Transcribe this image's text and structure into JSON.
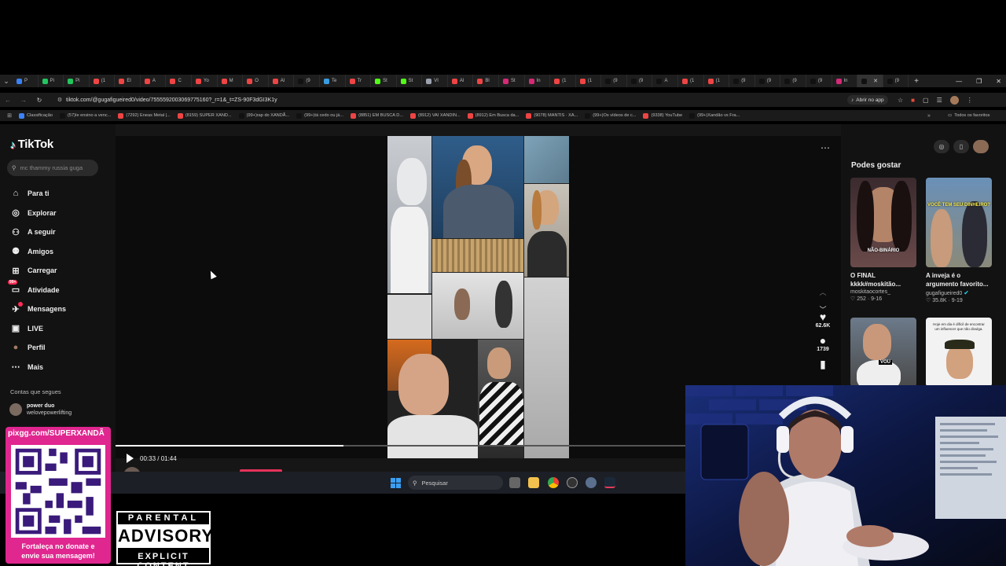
{
  "browser": {
    "tabs": [
      {
        "label": "P",
        "color": "#3b82f6"
      },
      {
        "label": "Pi",
        "color": "#22c55e"
      },
      {
        "label": "Pi",
        "color": "#22c55e"
      },
      {
        "label": "(1",
        "color": "#ef4444"
      },
      {
        "label": "El",
        "color": "#ef4444"
      },
      {
        "label": "A",
        "color": "#ef4444"
      },
      {
        "label": "C",
        "color": "#ef4444"
      },
      {
        "label": "Yo",
        "color": "#ef4444"
      },
      {
        "label": "M",
        "color": "#ef4444"
      },
      {
        "label": "O",
        "color": "#ef4444"
      },
      {
        "label": "Al",
        "color": "#ef4444"
      },
      {
        "label": "(9",
        "color": "#111111"
      },
      {
        "label": "Te",
        "color": "#3b9de0"
      },
      {
        "label": "Tr",
        "color": "#ef4444"
      },
      {
        "label": "St",
        "color": "#53fc18"
      },
      {
        "label": "St",
        "color": "#53fc18"
      },
      {
        "label": "VI",
        "color": "#9ca3af"
      },
      {
        "label": "Al",
        "color": "#ef4444"
      },
      {
        "label": "Bl",
        "color": "#ef4444"
      },
      {
        "label": "St",
        "color": "#d62976"
      },
      {
        "label": "In",
        "color": "#d62976"
      },
      {
        "label": "(1",
        "color": "#ef4444"
      },
      {
        "label": "(1",
        "color": "#ef4444"
      },
      {
        "label": "(9",
        "color": "#111111"
      },
      {
        "label": "(9",
        "color": "#111111"
      },
      {
        "label": "A",
        "color": "#111111"
      },
      {
        "label": "(1",
        "color": "#ef4444"
      },
      {
        "label": "(1",
        "color": "#ef4444"
      },
      {
        "label": "(9",
        "color": "#111111"
      },
      {
        "label": "(9",
        "color": "#111111"
      },
      {
        "label": "(9",
        "color": "#111111"
      },
      {
        "label": "(9",
        "color": "#111111"
      },
      {
        "label": "In",
        "color": "#d62976"
      },
      {
        "label": "",
        "color": "#111111",
        "active": true
      },
      {
        "label": "(9",
        "color": "#111111"
      }
    ],
    "url": "tiktok.com/@gugafigueired0/video/7555592003069775160?_r=1&_t=ZS-90F3dGI3K1y",
    "open_in_app": "Abrir no app",
    "bookmarks": [
      {
        "label": "Classificação",
        "color": "#3b82f6"
      },
      {
        "label": "(57)Ie ensino a venc...",
        "color": "#111111"
      },
      {
        "label": "(7292) Eneas Metal |...",
        "color": "#ef4444"
      },
      {
        "label": "(8159) SUPER XAND...",
        "color": "#ef4444"
      },
      {
        "label": "(99+)rap do XANDÃ...",
        "color": "#111111"
      },
      {
        "label": "(99+)tá cedo ou já...",
        "color": "#111111"
      },
      {
        "label": "(8851) EM BUSCA D...",
        "color": "#ef4444"
      },
      {
        "label": "(8912) VAI XANDIN...",
        "color": "#ef4444"
      },
      {
        "label": "(8912) Em Busca da...",
        "color": "#ef4444"
      },
      {
        "label": "(9078) MANTIS · XA...",
        "color": "#ef4444"
      },
      {
        "label": "(99+)Os vídeos de c...",
        "color": "#111111"
      },
      {
        "label": "(9338) YouTube",
        "color": "#ef4444"
      },
      {
        "label": "(99+)Xandão vs Fra...",
        "color": "#111111"
      }
    ],
    "all_favorites": "Todos os favoritos"
  },
  "tiktok": {
    "logo": "TikTok",
    "search_placeholder": "mc thammy russia guga",
    "nav": [
      {
        "label": "Para ti",
        "icon": "home-icon",
        "glyph": "⌂"
      },
      {
        "label": "Explorar",
        "icon": "compass-icon",
        "glyph": "◎"
      },
      {
        "label": "A seguir",
        "icon": "user-follow-icon",
        "glyph": "⚇"
      },
      {
        "label": "Amigos",
        "icon": "friends-icon",
        "glyph": "⚉"
      },
      {
        "label": "Carregar",
        "icon": "upload-icon",
        "glyph": "⊞"
      },
      {
        "label": "Atividade",
        "icon": "inbox-icon",
        "glyph": "▭",
        "badge": "99+"
      },
      {
        "label": "Mensagens",
        "icon": "messages-icon",
        "glyph": "✈",
        "dot": true
      },
      {
        "label": "LIVE",
        "icon": "live-icon",
        "glyph": "▣"
      },
      {
        "label": "Perfil",
        "icon": "avatar-icon",
        "glyph": "●"
      },
      {
        "label": "Mais",
        "icon": "more-icon",
        "glyph": "⋯"
      }
    ],
    "following_title": "Contas que segues",
    "following": [
      {
        "name": "power duo",
        "handle": "welovepowerlifting"
      }
    ],
    "video": {
      "time": "00:33 / 01:44",
      "progress": 0.4,
      "likes": "62.6K",
      "comments": "1739",
      "author": "gugafigueired0"
    },
    "suggestions_title": "Podes gostar",
    "suggestions": [
      {
        "caption": "O FINAL kkkk#moskitão...",
        "user": "moskitaocortes_",
        "likes": "252",
        "date": "9-16",
        "overlay": "NÃO-BINÁRIO",
        "verified": false
      },
      {
        "caption": "A inveja é o argumento favorito...",
        "user": "gugafigueired0",
        "likes": "35.8K",
        "date": "9-19",
        "overlay": "VOCÊ TEM SEU DINHEIRO?",
        "verified": true
      },
      {
        "caption": "",
        "user": "",
        "likes": "",
        "date": "",
        "overlay": "VOU",
        "verified": false
      },
      {
        "caption": "",
        "user": "",
        "likes": "",
        "date": "",
        "overlay": "Hoje em dia é difícil de encontrar um influencer que não divulga.",
        "verified": false
      }
    ]
  },
  "taskbar": {
    "search_label": "Pesquisar"
  },
  "overlay": {
    "qr_url": "pixgg.com/SUPERXANDÃ",
    "qr_line1": "Fortaleça no donate e",
    "qr_line2": "envie sua mensagem!",
    "pa_top": "PARENTAL",
    "pa_mid": "ADVISORY",
    "pa_bot": "EXPLICIT CONTENT"
  }
}
